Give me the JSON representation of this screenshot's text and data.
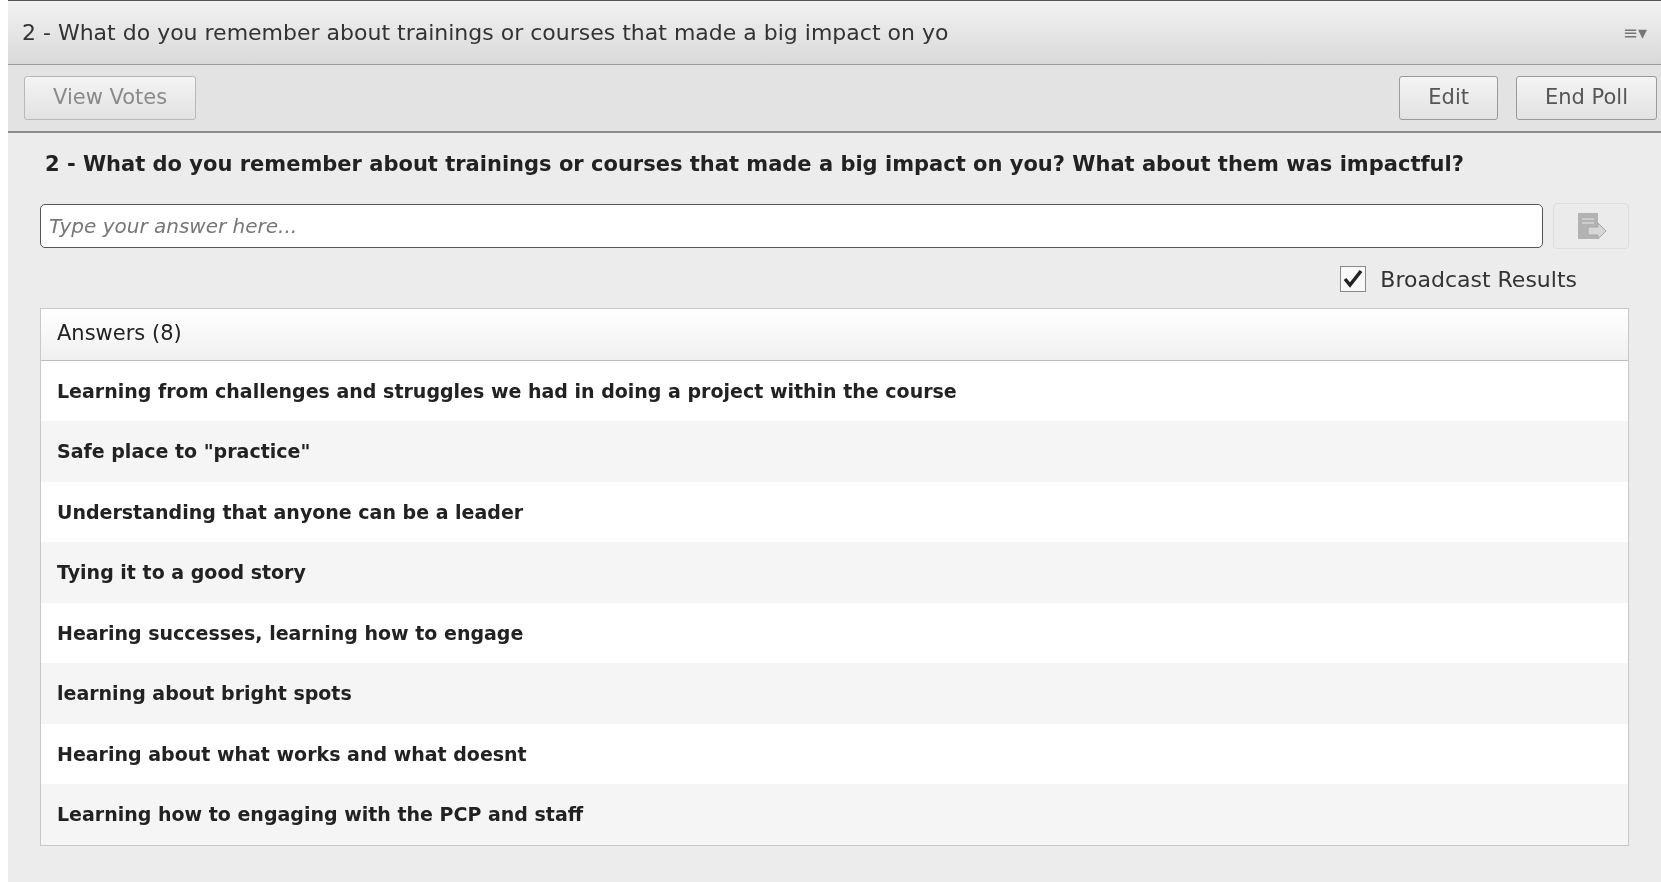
{
  "panel": {
    "title": "2 - What do you remember about trainings or courses that made a big impact on yo",
    "menu_icon": "≡▾"
  },
  "toolbar": {
    "left_buttons": [
      {
        "label": "View Votes",
        "disabled": true
      }
    ],
    "right_buttons": [
      {
        "label": "Edit",
        "disabled": false
      },
      {
        "label": "End Poll",
        "disabled": false
      }
    ]
  },
  "question": "2 - What do you remember about trainings or courses that made a big impact on you? What about them was impactful?",
  "answer_field": {
    "placeholder": "Type your answer here..."
  },
  "send_button": {
    "disabled": true
  },
  "broadcast": {
    "label": "Broadcast Results",
    "checked": true
  },
  "answers": {
    "header": "Answers (8)",
    "rows": [
      "Learning from challenges and struggles we had in doing a project within the course",
      "Safe place to \"practice\"",
      "Understanding that anyone can be a leader",
      "Tying it to a good story",
      "Hearing successes, learning how to engage",
      "learning about bright spots",
      "Hearing about what works and what doesnt",
      "Learning how to engaging with the PCP and staff"
    ]
  }
}
